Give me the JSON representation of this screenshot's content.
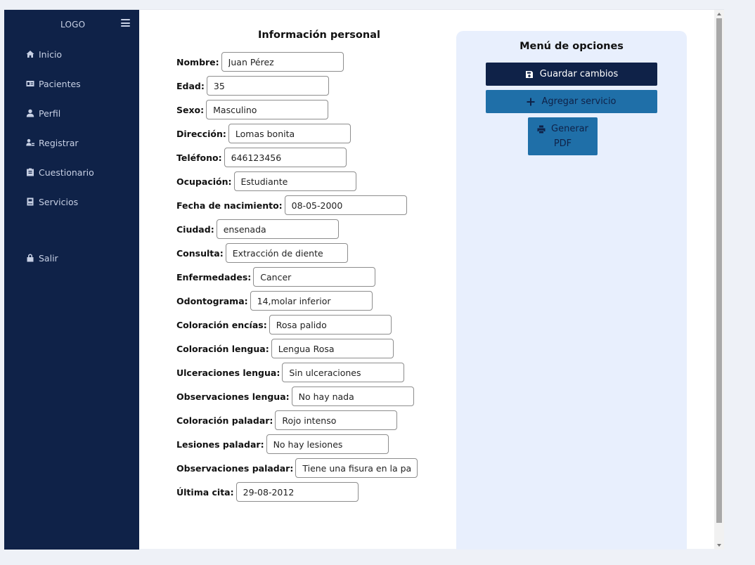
{
  "sidebar": {
    "logo": "LOGO",
    "items": [
      {
        "label": "Inicio",
        "icon": "home-icon"
      },
      {
        "label": "Pacientes",
        "icon": "id-card-icon"
      },
      {
        "label": "Perfil",
        "icon": "user-icon"
      },
      {
        "label": "Registrar",
        "icon": "user-plus-icon"
      },
      {
        "label": "Cuestionario",
        "icon": "clipboard-icon"
      },
      {
        "label": "Servicios",
        "icon": "book-icon"
      }
    ],
    "logout": {
      "label": "Salir",
      "icon": "lock-icon"
    }
  },
  "form": {
    "title": "Información personal",
    "fields": [
      {
        "label": "Nombre:",
        "value": "Juan Pérez"
      },
      {
        "label": "Edad:",
        "value": "35"
      },
      {
        "label": "Sexo:",
        "value": "Masculino"
      },
      {
        "label": "Dirección:",
        "value": "Lomas bonita"
      },
      {
        "label": "Teléfono:",
        "value": "646123456"
      },
      {
        "label": "Ocupación:",
        "value": "Estudiante"
      },
      {
        "label": "Fecha de nacimiento:",
        "value": "08-05-2000"
      },
      {
        "label": "Ciudad:",
        "value": "ensenada"
      },
      {
        "label": "Consulta:",
        "value": "Extracción de diente"
      },
      {
        "label": "Enfermedades:",
        "value": "Cancer"
      },
      {
        "label": "Odontograma:",
        "value": "14,molar inferior"
      },
      {
        "label": "Coloración encías:",
        "value": "Rosa palido"
      },
      {
        "label": "Coloración lengua:",
        "value": "Lengua Rosa"
      },
      {
        "label": "Ulceraciones lengua:",
        "value": "Sin ulceraciones"
      },
      {
        "label": "Observaciones lengua:",
        "value": "No hay nada"
      },
      {
        "label": "Coloración paladar:",
        "value": "Rojo intenso"
      },
      {
        "label": "Lesiones paladar:",
        "value": "No hay lesiones"
      },
      {
        "label": "Observaciones paladar:",
        "value": "Tiene una fisura en la par"
      },
      {
        "label": "Última cita:",
        "value": "29-08-2012"
      }
    ]
  },
  "options": {
    "title": "Menú de opciones",
    "save_label": "Guardar cambios",
    "add_label": "Agregar servicio",
    "pdf_label_line1": "Generar",
    "pdf_label_line2": "PDF"
  },
  "colors": {
    "sidebar_bg": "#0f2248",
    "primary_button": "#0f2248",
    "secondary_button": "#1f6fa8",
    "options_panel_bg": "#e8effd"
  }
}
